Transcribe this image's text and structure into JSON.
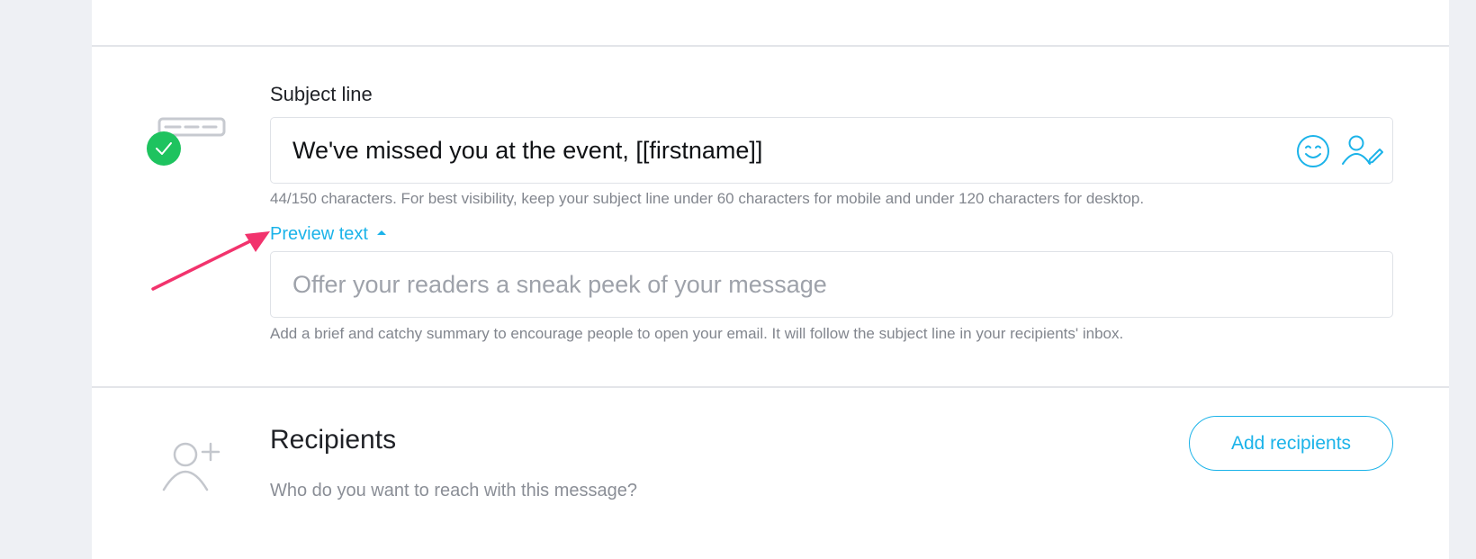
{
  "subject": {
    "label": "Subject line",
    "value": "We've missed you at the event, [[firstname]]",
    "hint": "44/150 characters. For best visibility, keep your subject line under 60 characters for mobile and under 120 characters for desktop.",
    "status_icon": "check-circle-icon",
    "status_color": "#1ec35f"
  },
  "preview": {
    "toggle_label": "Preview text",
    "placeholder": "Offer your readers a sneak peek of your message",
    "hint": "Add a brief and catchy summary to encourage people to open your email. It will follow the subject line in your recipients' inbox."
  },
  "recipients": {
    "title": "Recipients",
    "subtitle": "Who do you want to reach with this message?",
    "button_label": "Add recipients"
  },
  "colors": {
    "accent": "#1bb3e9",
    "annotation_arrow": "#f2336d"
  }
}
